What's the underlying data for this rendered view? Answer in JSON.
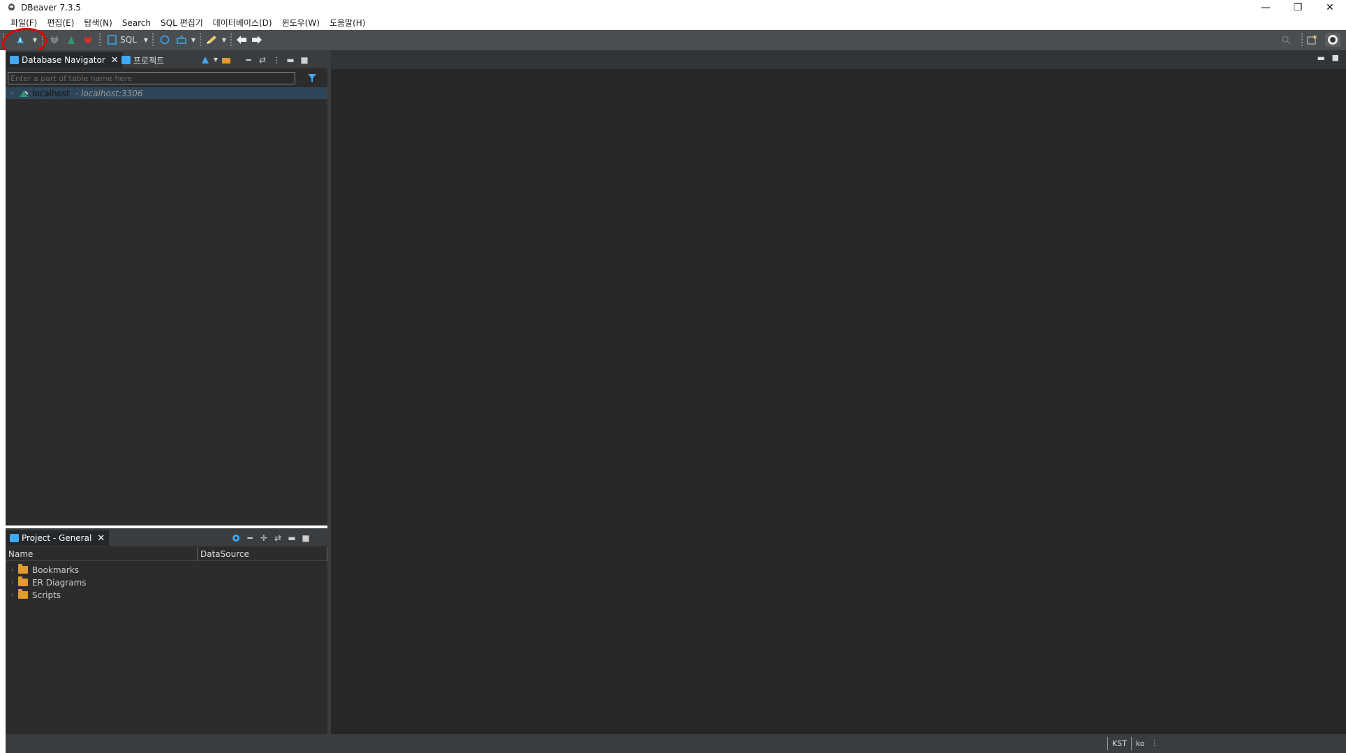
{
  "window": {
    "title": "DBeaver 7.3.5",
    "minimize": "—",
    "restore": "❐",
    "close": "✕"
  },
  "menu": [
    "파일(F)",
    "편집(E)",
    "탐색(N)",
    "Search",
    "SQL 편집기",
    "데이터베이스(D)",
    "윈도우(W)",
    "도움말(H)"
  ],
  "toolbar": {
    "sql_label": "SQL"
  },
  "navigator": {
    "tab_label": "Database Navigator",
    "tab_close": "✕",
    "project_tab_label": "프로젝트",
    "search_placeholder": "Enter a part of table name here",
    "connection": {
      "name": "localhost",
      "detail": "- localhost:3306"
    }
  },
  "project_panel": {
    "tab_label": "Project - General",
    "tab_close": "✕",
    "columns": [
      "Name",
      "DataSource"
    ],
    "items": [
      "Bookmarks",
      "ER Diagrams",
      "Scripts"
    ]
  },
  "status": {
    "timezone": "KST",
    "locale": "ko"
  },
  "colors": {
    "toolbar_bg": "#4a4e50",
    "panel_bg": "#2c2c2c",
    "editor_bg": "#272727",
    "selection": "#2f4558",
    "accent_blue": "#3fa9f5",
    "folder": "#e39a2f",
    "highlight_circle": "#e00000"
  }
}
